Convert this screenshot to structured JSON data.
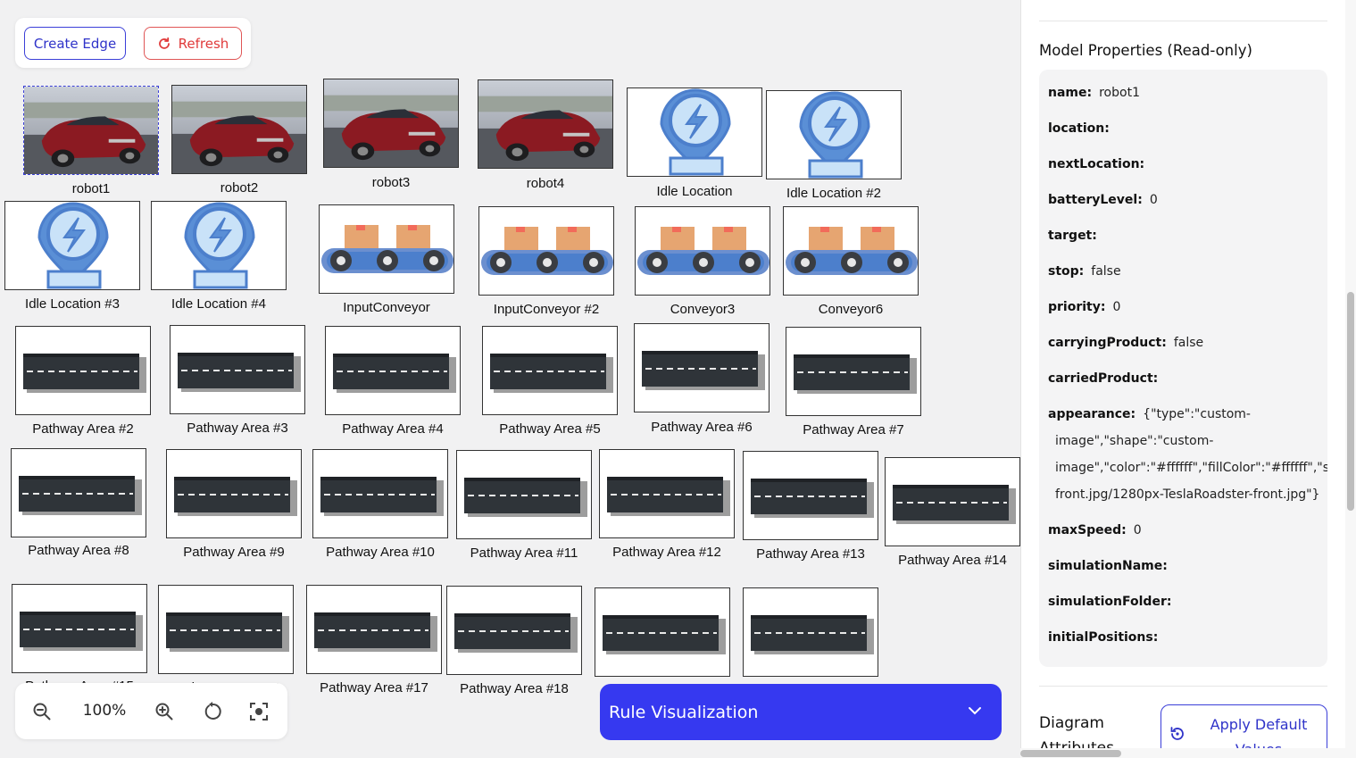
{
  "toolbar": {
    "create_edge_label": "Create Edge",
    "refresh_label": "Refresh",
    "refresh_icon": "refresh-icon"
  },
  "nodes": [
    {
      "label": "robot1",
      "type": "car",
      "selected": true
    },
    {
      "label": "robot2",
      "type": "car"
    },
    {
      "label": "robot3",
      "type": "car"
    },
    {
      "label": "robot4",
      "type": "car"
    },
    {
      "label": "Idle Location",
      "type": "idle"
    },
    {
      "label": "Idle Location #2",
      "type": "idle"
    },
    {
      "label": "Idle Location #3",
      "type": "idle"
    },
    {
      "label": "Idle Location #4",
      "type": "idle"
    },
    {
      "label": "InputConveyor",
      "type": "conveyor"
    },
    {
      "label": "InputConveyor #2",
      "type": "conveyor"
    },
    {
      "label": "Conveyor3",
      "type": "conveyor"
    },
    {
      "label": "Conveyor6",
      "type": "conveyor"
    },
    {
      "label": "Pathway Area #2",
      "type": "road"
    },
    {
      "label": "Pathway Area #3",
      "type": "road"
    },
    {
      "label": "Pathway Area #4",
      "type": "road"
    },
    {
      "label": "Pathway Area #5",
      "type": "road"
    },
    {
      "label": "Pathway Area #6",
      "type": "road"
    },
    {
      "label": "Pathway Area #7",
      "type": "road"
    },
    {
      "label": "Pathway Area #8",
      "type": "road"
    },
    {
      "label": "Pathway Area #9",
      "type": "road"
    },
    {
      "label": "Pathway Area #10",
      "type": "road"
    },
    {
      "label": "Pathway Area #11",
      "type": "road"
    },
    {
      "label": "Pathway Area #12",
      "type": "road"
    },
    {
      "label": "Pathway Area #13",
      "type": "road"
    },
    {
      "label": "Pathway Area #14",
      "type": "road"
    },
    {
      "label": "Pathway Area #15",
      "type": "road"
    },
    {
      "label": "Pathway Area #16",
      "type": "road"
    },
    {
      "label": "Pathway Area #17",
      "type": "road"
    },
    {
      "label": "Pathway Area #18",
      "type": "road"
    },
    {
      "label": "",
      "type": "road"
    },
    {
      "label": "",
      "type": "road"
    }
  ],
  "zoom": {
    "level": "100%"
  },
  "rule_visualization": {
    "title": "Rule Visualization"
  },
  "panel": {
    "title": "Model Properties (Read-only)",
    "properties": [
      {
        "key": "name:",
        "value": "robot1"
      },
      {
        "key": "location:",
        "value": ""
      },
      {
        "key": "nextLocation:",
        "value": ""
      },
      {
        "key": "batteryLevel:",
        "value": "0"
      },
      {
        "key": "target:",
        "value": ""
      },
      {
        "key": "stop:",
        "value": "false"
      },
      {
        "key": "priority:",
        "value": "0"
      },
      {
        "key": "carryingProduct:",
        "value": "false"
      },
      {
        "key": "carriedProduct:",
        "value": ""
      },
      {
        "key": "appearance:",
        "value": "{\"type\":\"custom-"
      },
      {
        "key": "",
        "value": "image\",\"shape\":\"custom-"
      },
      {
        "key": "",
        "value": "image\",\"color\":\"#ffffff\",\"fillColor\":\"#ffffff\",\"strokeC"
      },
      {
        "key": "",
        "value": "front.jpg/1280px-TeslaRoadster-front.jpg\"}"
      },
      {
        "key": "maxSpeed:",
        "value": "0"
      },
      {
        "key": "simulationName:",
        "value": ""
      },
      {
        "key": "simulationFolder:",
        "value": ""
      },
      {
        "key": "initialPositions:",
        "value": ""
      }
    ],
    "diagram_attributes_label": "Diagram Attributes",
    "apply_default_label": "Apply Default Values"
  },
  "colors": {
    "accent": "#3639f0",
    "refresh": "#e03b3b",
    "panel_bg": "#f4f4f5"
  }
}
